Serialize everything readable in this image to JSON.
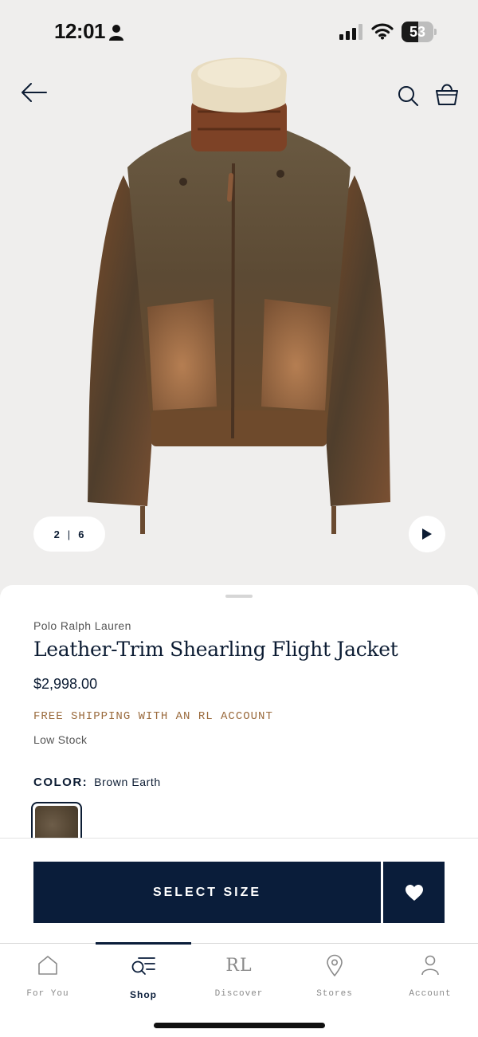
{
  "status_bar": {
    "time": "12:01",
    "battery_level": "53",
    "battery_fraction": 0.53,
    "icons": [
      "person-icon",
      "signal-icon",
      "wifi-icon",
      "battery-icon"
    ]
  },
  "header": {
    "icons": [
      "back-arrow-icon",
      "search-icon",
      "shopping-bag-icon"
    ]
  },
  "gallery": {
    "current": "2",
    "separator": "|",
    "total": "6",
    "play_icon": "play-icon"
  },
  "product": {
    "brand": "Polo Ralph Lauren",
    "title": "Leather-Trim Shearling Flight Jacket",
    "price": "$2,998.00",
    "shipping": "FREE SHIPPING WITH AN RL ACCOUNT",
    "stock": "Low Stock",
    "color_label": "COLOR:",
    "color_value": "Brown Earth"
  },
  "actions": {
    "select_size": "SELECT SIZE",
    "wishlist_icon": "heart-icon"
  },
  "tabs": [
    {
      "label": "For You",
      "icon": "home-icon",
      "active": false
    },
    {
      "label": "Shop",
      "icon": "shop-search-icon",
      "active": true
    },
    {
      "label": "Discover",
      "icon": "rl-logo-icon",
      "mark": "RL",
      "active": false
    },
    {
      "label": "Stores",
      "icon": "location-pin-icon",
      "active": false
    },
    {
      "label": "Account",
      "icon": "person-icon",
      "active": false
    }
  ],
  "colors": {
    "navy": "#0a1d3a",
    "shipping_accent": "#9a6a3c",
    "hero_background": "#efeeed"
  }
}
